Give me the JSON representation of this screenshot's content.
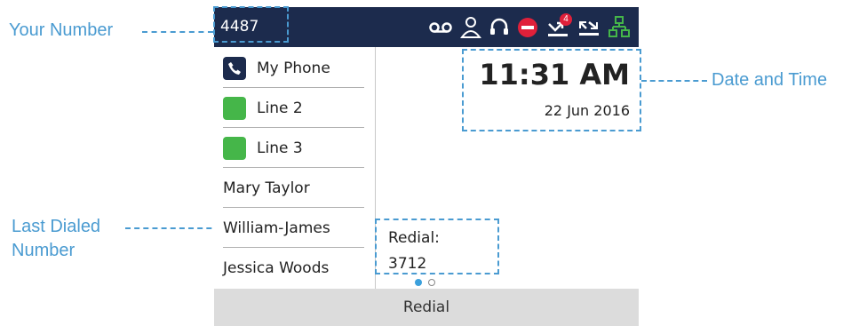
{
  "callouts": {
    "your_number": "Your Number",
    "date_time": "Date and Time",
    "last_dialed_line1": "Last Dialed",
    "last_dialed_line2": "Number"
  },
  "status_bar": {
    "extension": "4487",
    "icons": [
      "voicemail-icon",
      "presence-icon",
      "headset-icon",
      "do-not-disturb-icon",
      "missed-calls-icon",
      "call-forward-icon",
      "network-icon"
    ],
    "missed_count": "4",
    "colors": {
      "background": "#1c2b4d",
      "dnd": "#e0203a",
      "badge": "#e0203a",
      "network": "#45b649"
    }
  },
  "lines": [
    {
      "label": "My Phone",
      "icon": "phone-icon"
    },
    {
      "label": "Line 2",
      "icon": "line-key-green"
    },
    {
      "label": "Line 3",
      "icon": "line-key-green"
    },
    {
      "label": "Mary Taylor"
    },
    {
      "label": "William-James"
    },
    {
      "label": "Jessica Woods"
    }
  ],
  "clock": {
    "time": "11:31 AM",
    "date": "22 Jun 2016"
  },
  "redial": {
    "label": "Redial:",
    "number": "3712"
  },
  "page_indicator": {
    "current": 1,
    "total": 2
  },
  "softkeys": [
    "Redial"
  ],
  "accent_color": "#4a9bd1"
}
